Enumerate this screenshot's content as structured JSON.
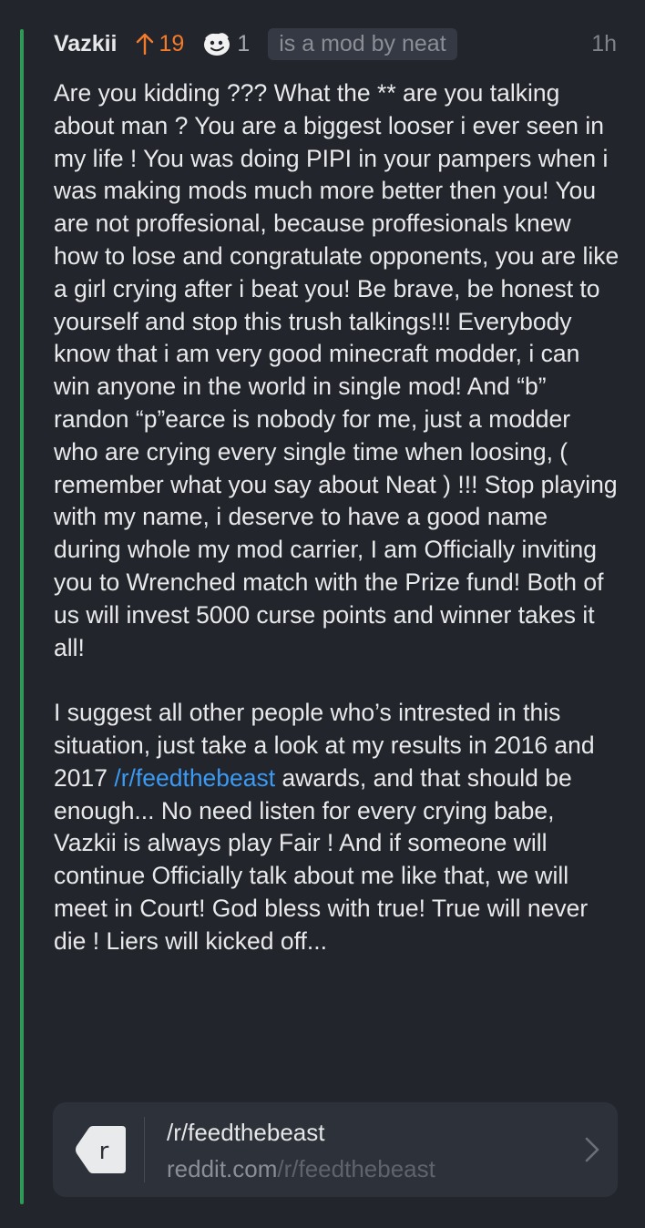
{
  "comment": {
    "author": "Vazkii",
    "score": "19",
    "award_count": "1",
    "flair": "is a mod by neat",
    "time": "1h",
    "body": {
      "p1_before": "Are you kidding ??? What the ** are you talking about man ? You are a biggest looser i ever seen in my life ! You was doing PIPI in your pampers when i was making mods much more better then you! You are not proffesional, because proffesionals knew how to lose and congratulate opponents, you are like a girl crying after i beat you! Be brave, be honest to yourself and stop this trush talkings!!! Everybody know that i am very good minecraft modder, i can win anyone in the world in single mod! And “b” randon “p”earce is nobody for me, just a modder who are crying every single time when loosing, ( remember what you say about Neat ) !!! Stop playing with my name, i deserve to have a good name during whole my mod carrier, I am Officially inviting you to Wrenched match with the Prize fund! Both of us will invest 5000 curse points and winner takes it all!",
      "p2_before": "I suggest all other people who’s intrested in this situation, just take a look at my results in 2016 and 2017 ",
      "p2_link": "/r/feedthebeast",
      "p2_after": " awards, and that should be enough... No need listen for every crying babe, Vazkii is always play Fair ! And if someone will continue Officially talk about me like that, we will meet in Court! God bless with true! True will never die ! Liers will kicked off..."
    }
  },
  "link_card": {
    "title": "/r/feedthebeast",
    "domain": "reddit.com",
    "path": "/r/feedthebeast",
    "thumb_letter": "r"
  },
  "colors": {
    "background": "#22252b",
    "thread_line": "#2f9a58",
    "upvote": "#f47b2a",
    "link": "#3a9af5"
  },
  "icons": [
    "upvote-arrow-icon",
    "award-icon",
    "link-thumbnail-icon",
    "chevron-right-icon"
  ]
}
